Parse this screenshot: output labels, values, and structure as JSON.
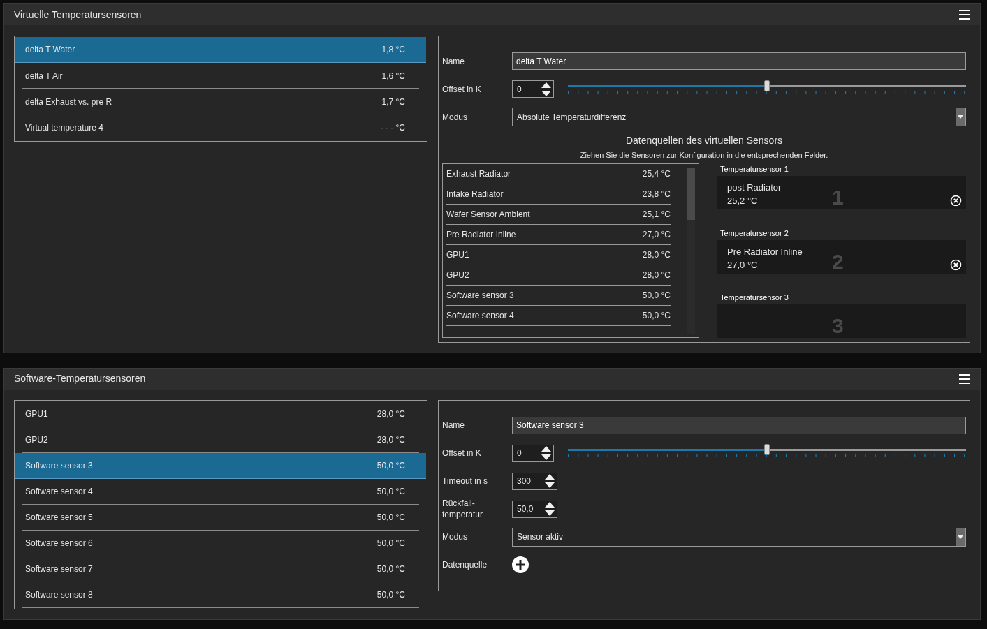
{
  "sections": [
    {
      "title": "Virtuelle Temperatursensoren",
      "items": [
        {
          "name": "delta T Water",
          "value": "1,8 °C",
          "selected": true
        },
        {
          "name": "delta T Air",
          "value": "1,6 °C",
          "selected": false
        },
        {
          "name": "delta Exhaust vs. pre R",
          "value": "1,7 °C",
          "selected": false
        },
        {
          "name": "Virtual temperature 4",
          "value": "- - - °C",
          "selected": false
        }
      ],
      "fields": [
        {
          "kind": "text",
          "label": "Name",
          "value": "delta T Water"
        },
        {
          "kind": "offset",
          "label": "Offset in K",
          "value": "0",
          "level": 0.5
        },
        {
          "kind": "select",
          "label": "Modus",
          "value": "Absolute Temperaturdifferenz"
        }
      ],
      "sources": {
        "title": "Datenquellen des virtuellen Sensors",
        "hint": "Ziehen Sie die Sensoren zur Konfiguration in die entsprechenden Felder.",
        "items": [
          {
            "name": "Exhaust Radiator",
            "value": "25,4 °C"
          },
          {
            "name": "Intake Radiator",
            "value": "23,8 °C"
          },
          {
            "name": "Wafer Sensor Ambient",
            "value": "25,1 °C"
          },
          {
            "name": "Pre Radiator Inline",
            "value": "27,0 °C"
          },
          {
            "name": "GPU1",
            "value": "28,0 °C"
          },
          {
            "name": "GPU2",
            "value": "28,0 °C"
          },
          {
            "name": "Software sensor 3",
            "value": "50,0 °C"
          },
          {
            "name": "Software sensor 4",
            "value": "50,0 °C"
          }
        ],
        "slots": [
          {
            "label": "Temperatursensor 1",
            "number": "1",
            "name": "post Radiator",
            "value": "25,2 °C"
          },
          {
            "label": "Temperatursensor 2",
            "number": "2",
            "name": "Pre Radiator Inline",
            "value": "27,0 °C"
          },
          {
            "label": "Temperatursensor 3",
            "number": "3"
          }
        ]
      }
    },
    {
      "title": "Software-Temperatursensoren",
      "items": [
        {
          "name": "GPU1",
          "value": "28,0 °C",
          "selected": false
        },
        {
          "name": "GPU2",
          "value": "28,0 °C",
          "selected": false
        },
        {
          "name": "Software sensor 3",
          "value": "50,0 °C",
          "selected": true
        },
        {
          "name": "Software sensor 4",
          "value": "50,0 °C",
          "selected": false
        },
        {
          "name": "Software sensor 5",
          "value": "50,0 °C",
          "selected": false
        },
        {
          "name": "Software sensor 6",
          "value": "50,0 °C",
          "selected": false
        },
        {
          "name": "Software sensor 7",
          "value": "50,0 °C",
          "selected": false
        },
        {
          "name": "Software sensor 8",
          "value": "50,0 °C",
          "selected": false
        }
      ],
      "fields": [
        {
          "kind": "text",
          "label": "Name",
          "value": "Software sensor 3"
        },
        {
          "kind": "offset",
          "label": "Offset in K",
          "value": "0",
          "level": 0.5
        },
        {
          "kind": "spin",
          "label": "Timeout in s",
          "value": "300"
        },
        {
          "kind": "spin",
          "label": "Rückfall-temperatur",
          "value": "50,0"
        },
        {
          "kind": "select",
          "label": "Modus",
          "value": "Sensor aktiv"
        },
        {
          "kind": "add",
          "label": "Datenquelle"
        }
      ]
    }
  ]
}
